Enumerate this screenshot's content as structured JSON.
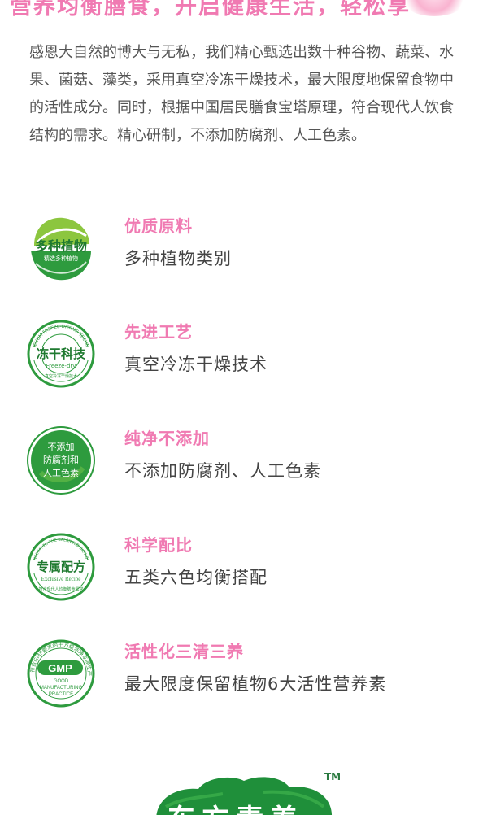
{
  "banner": {
    "text": "营养均衡膳食，开启健康生活，轻松享"
  },
  "intro": {
    "text": "感恩大自然的博大与无私，我们精心甄选出数十种谷物、蔬菜、水果、菌菇、藻类，采用真空冷冻干燥技术，最大限度地保留食物中的活性成分。同时，根据中国居民膳食宝塔原理，符合现代人饮食结构的需求。精心研制，不添加防腐剂、人工色素。"
  },
  "features": [
    {
      "title": "优质原料",
      "desc": "多种植物类别",
      "badge": {
        "icon": "leaf-badge-icon",
        "main": "多种植物",
        "sub": "精选多种植物"
      }
    },
    {
      "title": "先进工艺",
      "desc": "真空冷冻干燥技术",
      "badge": {
        "icon": "freeze-dry-seal-icon",
        "main": "冻干科技",
        "sub": "Freeze-dry",
        "ring": "VACUUM FREEZE-DRYING TECHNOLOGY",
        "bottom": "真空冷冻干燥技术"
      }
    },
    {
      "title": "纯净不添加",
      "desc": "不添加防腐剂、人工色素",
      "badge": {
        "icon": "no-additive-badge-icon",
        "line1": "不添加",
        "line2": "防腐剂和",
        "line3": "人工色素"
      }
    },
    {
      "title": "科学配比",
      "desc": "五类六色均衡搭配",
      "badge": {
        "icon": "exclusive-recipe-seal-icon",
        "main": "专属配方",
        "sub": "Exclusive Recipe",
        "ring": "CONFORM TO THE BALANCED DIET OF MODERN PEOPLE",
        "bottom": "符合现代人均衡膳食需求"
      }
    },
    {
      "title": "活性化三清三养",
      "desc": "最大限度保留植物6大活性营养素",
      "badge": {
        "icon": "gmp-seal-icon",
        "main": "GMP",
        "ring": "符合GMP要求的十万级洁净车间生产",
        "sub1": "GOOD",
        "sub2": "MANUFACTURING",
        "sub3": "PRACTICE"
      }
    }
  ],
  "bottom": {
    "tm": "TM",
    "logo_text": "东方素养"
  },
  "colors": {
    "accent_pink": "#f07ab2",
    "brand_green": "#2a9a3e",
    "text_gray": "#555555"
  }
}
